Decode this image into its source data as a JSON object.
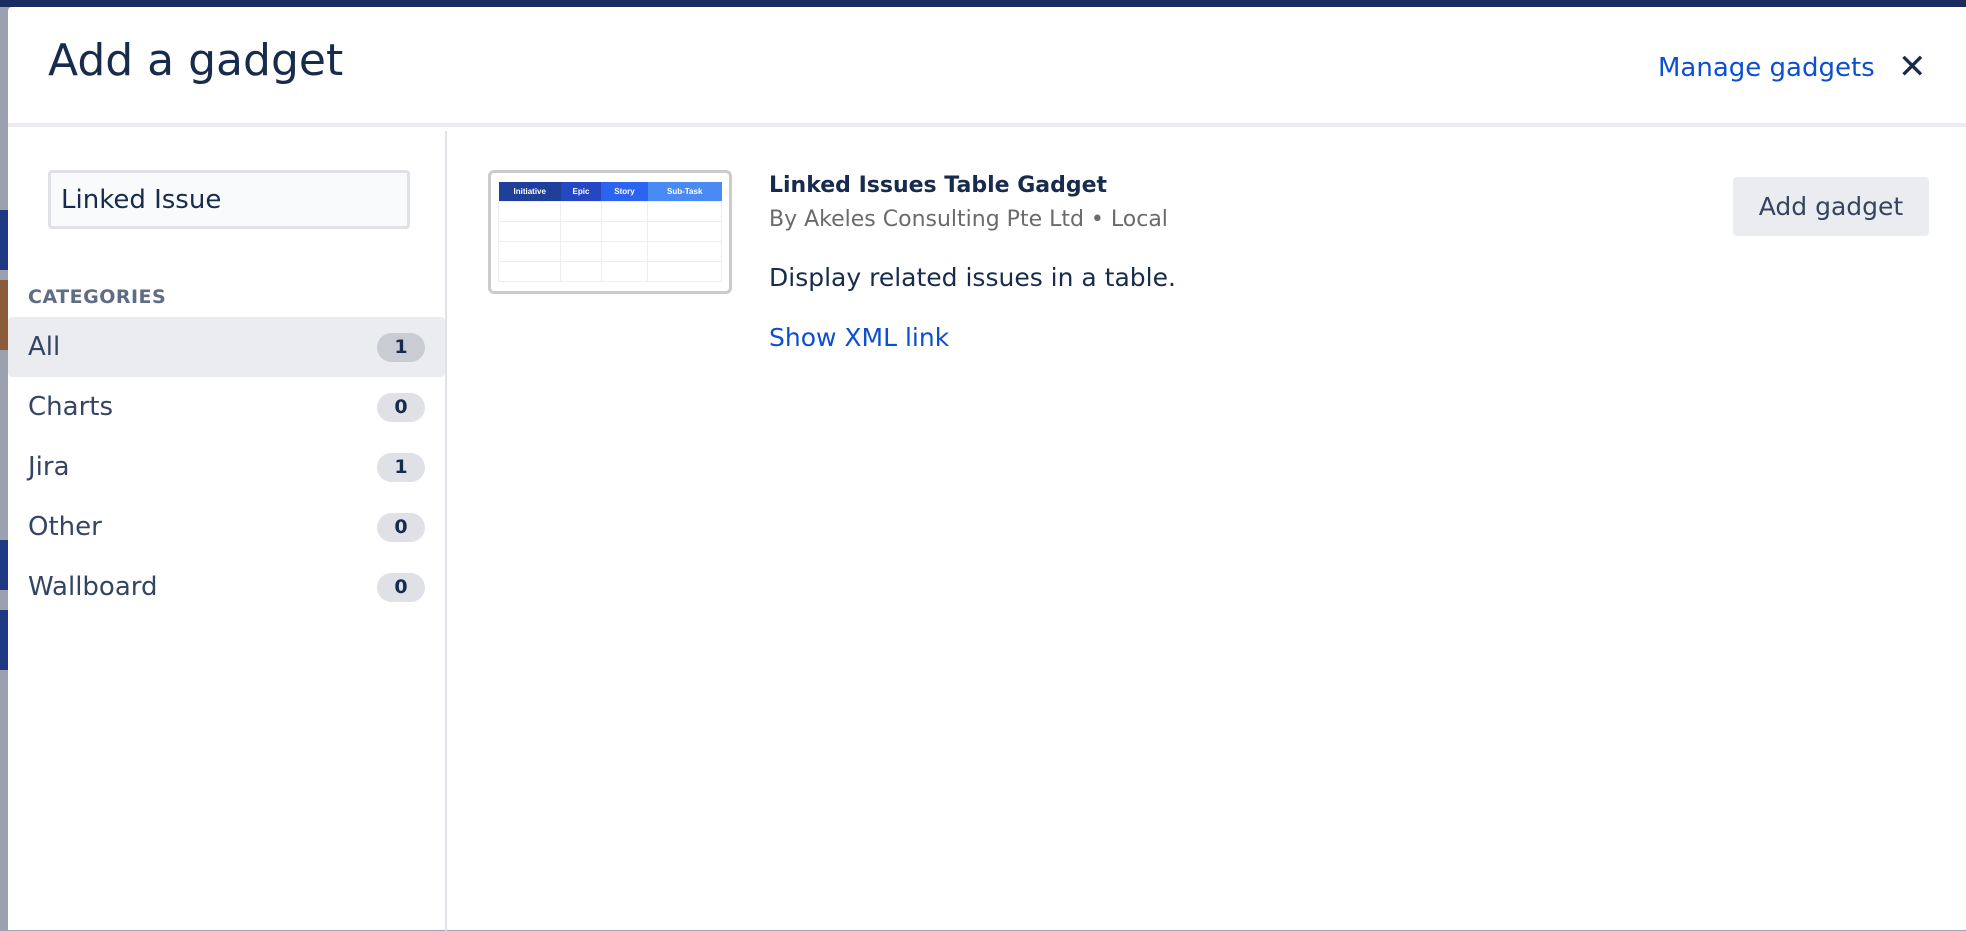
{
  "dialog": {
    "title": "Add a gadget",
    "manage_link": "Manage gadgets",
    "close_icon": "close-icon"
  },
  "sidebar": {
    "search_value": "Linked Issue",
    "categories_heading": "CATEGORIES",
    "categories": [
      {
        "label": "All",
        "count": "1",
        "selected": true
      },
      {
        "label": "Charts",
        "count": "0"
      },
      {
        "label": "Jira",
        "count": "1"
      },
      {
        "label": "Other",
        "count": "0"
      },
      {
        "label": "Wallboard",
        "count": "0"
      }
    ]
  },
  "gadget": {
    "thumbnail_columns": [
      "Initiative",
      "Epic",
      "Story",
      "Sub-Task"
    ],
    "thumbnail_colors": [
      "#1e3f9a",
      "#2447c4",
      "#2c63f0",
      "#4a8af4"
    ],
    "title": "Linked Issues Table Gadget",
    "byline": "By Akeles Consulting Pte Ltd • Local",
    "description": "Display related issues in a table.",
    "xml_link": "Show XML link",
    "add_button": "Add gadget"
  },
  "colors": {
    "link": "#0c4fd1",
    "text": "#172b4d"
  }
}
